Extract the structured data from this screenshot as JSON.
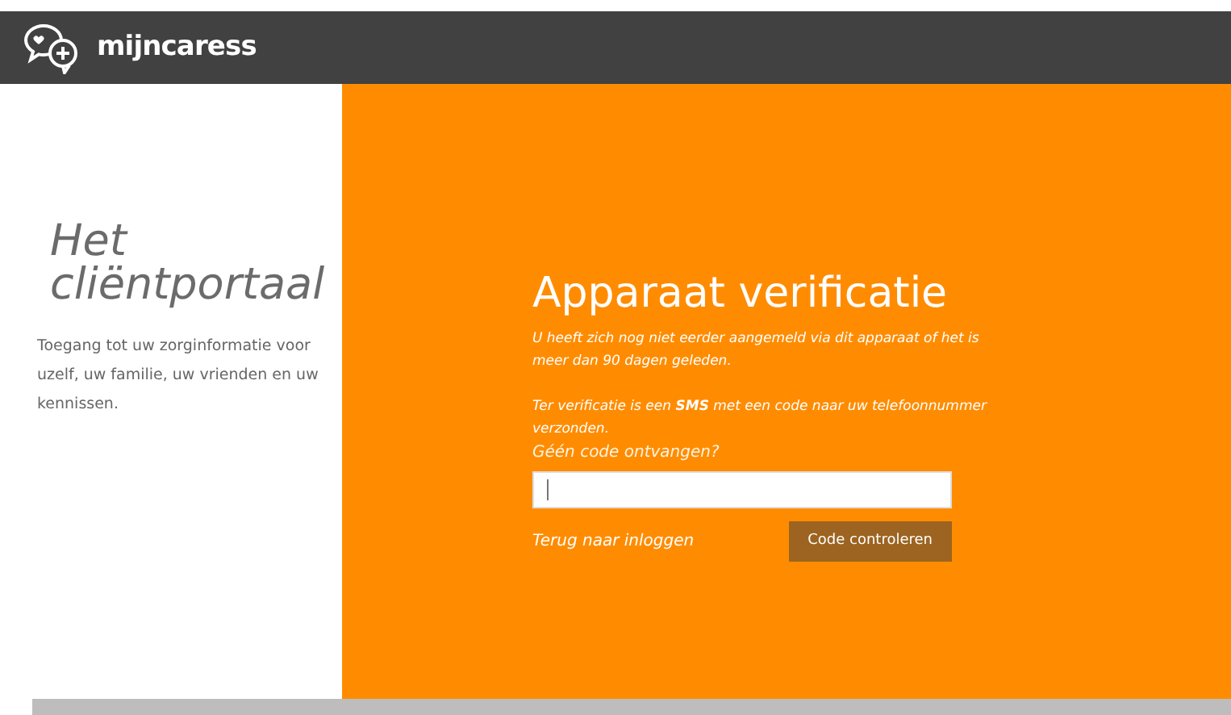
{
  "header": {
    "brand": "mijncaress"
  },
  "intro": {
    "title_line_1": "Het",
    "title_line_2": "cliëntportaal",
    "description": "Toegang tot uw zorginformatie voor uzelf, uw familie, uw vrienden en uw kennissen."
  },
  "verification": {
    "title": "Apparaat verificatie",
    "message_1": "U heeft zich nog niet eerder aangemeld via dit apparaat of het is meer dan 90 dagen geleden.",
    "message_2": "Ter verificatie is een **SMS** met een code naar uw telefoonnummer verzonden.",
    "resend_link": "Géén code ontvangen?",
    "back_link": "Terug naar inloggen",
    "submit_button": "Code controleren"
  }
}
